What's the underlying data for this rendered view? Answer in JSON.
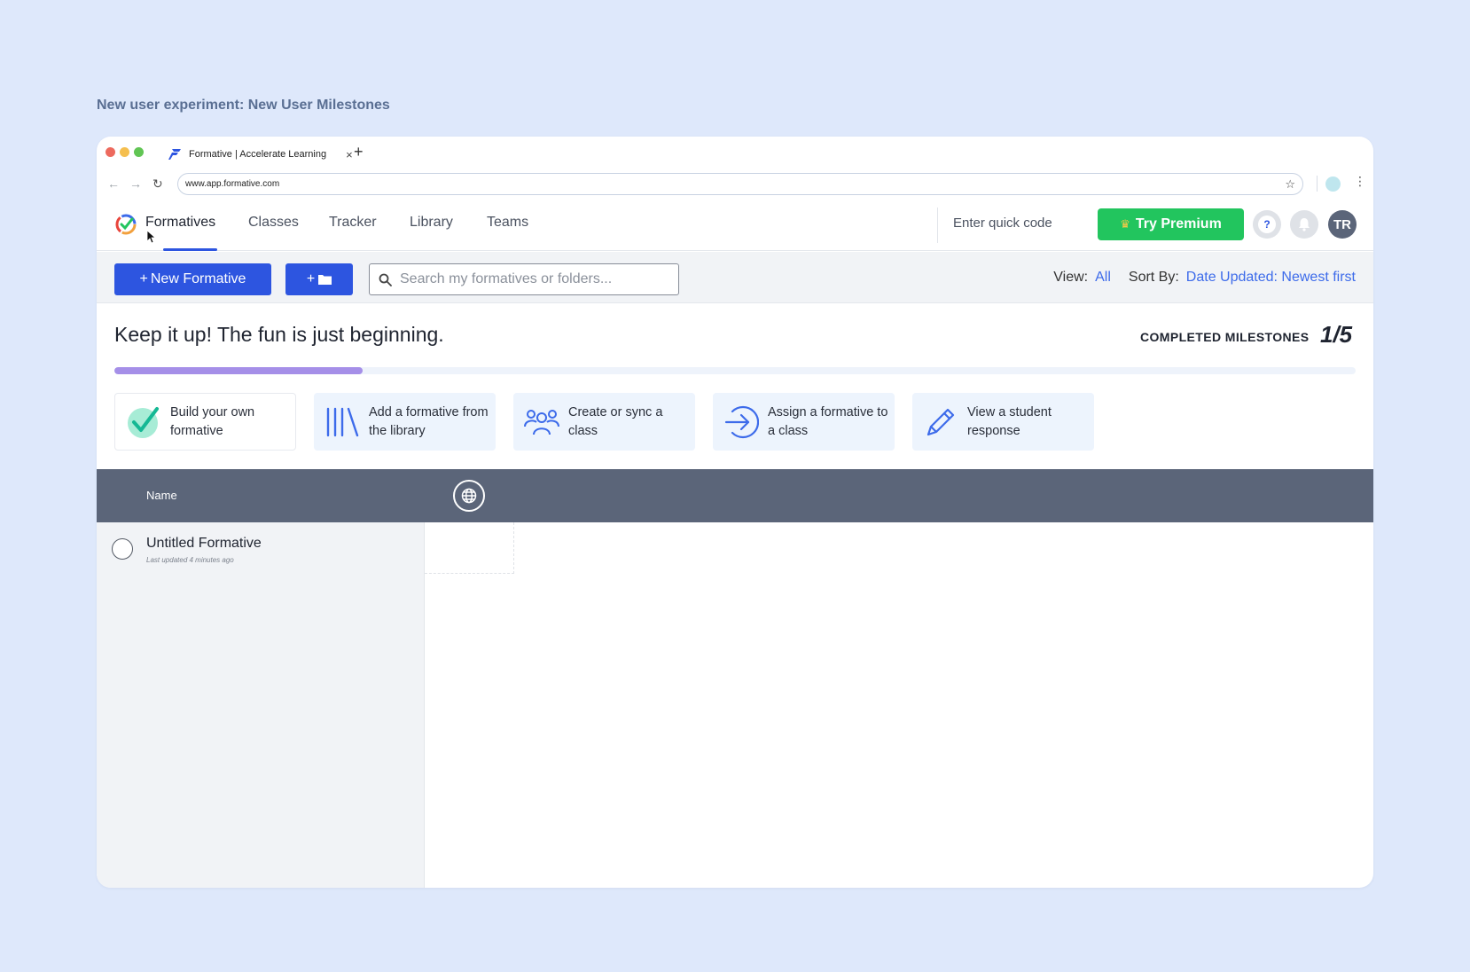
{
  "caption": "New user experiment: New User Milestones",
  "browser": {
    "tab_title": "Formative | Accelerate Learning",
    "tab_close": "×",
    "new_tab": "+",
    "url": "www.app.formative.com"
  },
  "nav": {
    "items": [
      "Formatives",
      "Classes",
      "Tracker",
      "Library",
      "Teams"
    ],
    "active": "Formatives",
    "quick_code_placeholder": "Enter quick code",
    "premium_label": "Try Premium",
    "help_label": "?",
    "avatar_initials": "TR"
  },
  "toolbar": {
    "new_formative_label": "New Formative",
    "new_folder_label": "+",
    "search_placeholder": "Search my formatives or folders...",
    "view_label": "View:",
    "view_value": "All",
    "sort_label": "Sort By:",
    "sort_value": "Date Updated: Newest first"
  },
  "milestones": {
    "title": "Keep it up! The fun is just beginning.",
    "label": "COMPLETED MILESTONES",
    "count": "1/5",
    "progress_fraction": 0.2,
    "items": [
      {
        "label": "Build your own formative",
        "icon": "checkmark-icon",
        "done": true
      },
      {
        "label": "Add a formative from the library",
        "icon": "library-icon",
        "done": false
      },
      {
        "label": "Create or sync a class",
        "icon": "users-icon",
        "done": false
      },
      {
        "label": "Assign a formative to a class",
        "icon": "assign-arrow-icon",
        "done": false
      },
      {
        "label": "View a student response",
        "icon": "pencil-icon",
        "done": false
      }
    ]
  },
  "table": {
    "name_header": "Name",
    "rows": [
      {
        "name": "Untitled Formative",
        "updated": "Last updated 4 minutes ago"
      }
    ]
  },
  "colors": {
    "primary": "#2d55e0",
    "premium": "#22c55e",
    "progress": "#a58fe8",
    "header": "#5b6579",
    "background": "#dee8fb"
  }
}
